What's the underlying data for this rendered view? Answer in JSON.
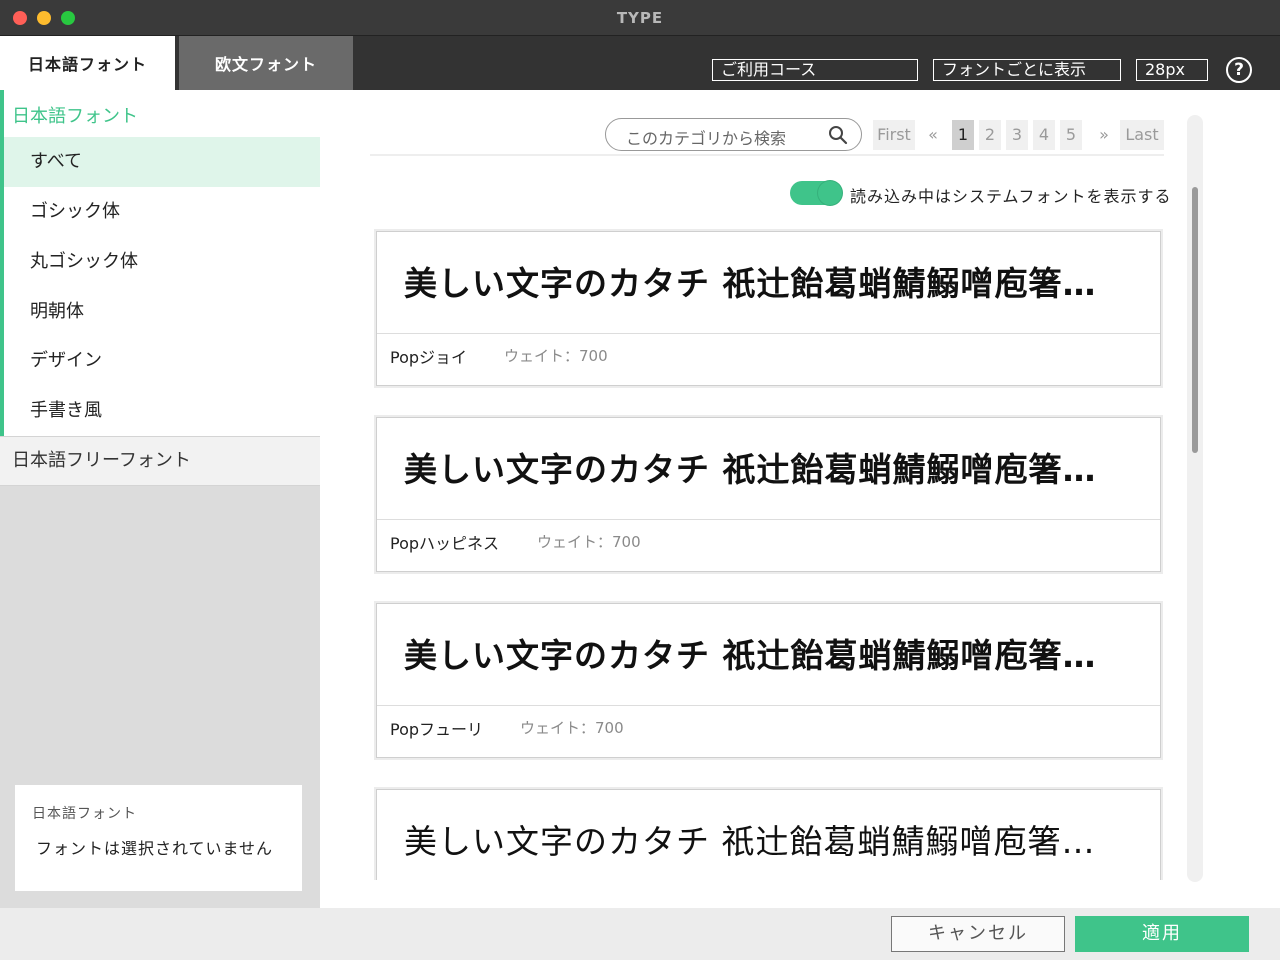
{
  "window": {
    "title": "TYPE"
  },
  "tabs": [
    {
      "label": "日本語フォント",
      "active": true
    },
    {
      "label": "欧文フォント",
      "active": false
    }
  ],
  "toolbar": {
    "course_label": "ご利用コース",
    "display_label": "フォントごとに表示",
    "size_value": "28px",
    "help_glyph": "?"
  },
  "sidebar": {
    "heading": "日本語フォント",
    "items": [
      {
        "label": "すべて",
        "active": true
      },
      {
        "label": "ゴシック体"
      },
      {
        "label": "丸ゴシック体"
      },
      {
        "label": "明朝体"
      },
      {
        "label": "デザイン"
      },
      {
        "label": "手書き風"
      }
    ],
    "free_label": "日本語フリーフォント",
    "selection": {
      "title": "日本語フォント",
      "message": "フォントは選択されていません"
    }
  },
  "main": {
    "search_placeholder": "このカテゴリから検索",
    "pagination": {
      "first": "First",
      "prev": "«",
      "pages": [
        "1",
        "2",
        "3",
        "4",
        "5"
      ],
      "current": "1",
      "next": "»",
      "last": "Last"
    },
    "toggle": {
      "on": true,
      "label": "読み込み中はシステムフォントを表示する"
    },
    "fonts": [
      {
        "preview": "美しい文字のカタチ 祇辻飴葛蛸鯖鰯噌庖箸…",
        "name": "Popジョイ",
        "weight": "ウェイト：700"
      },
      {
        "preview": "美しい文字のカタチ 祇辻飴葛蛸鯖鰯噌庖箸…",
        "name": "Popハッピネス",
        "weight": "ウェイト：700"
      },
      {
        "preview": "美しい文字のカタチ 祇辻飴葛蛸鯖鰯噌庖箸…",
        "name": "Popフューリ",
        "weight": "ウェイト：700"
      },
      {
        "preview": "美しい文字のカタチ 祇辻飴葛蛸鯖鰯噌庖箸…"
      }
    ]
  },
  "footer": {
    "cancel": "キャンセル",
    "apply": "適用"
  },
  "colors": {
    "accent": "#3fc48a",
    "topbar": "#333333",
    "titlebar": "#3a3a3a"
  }
}
